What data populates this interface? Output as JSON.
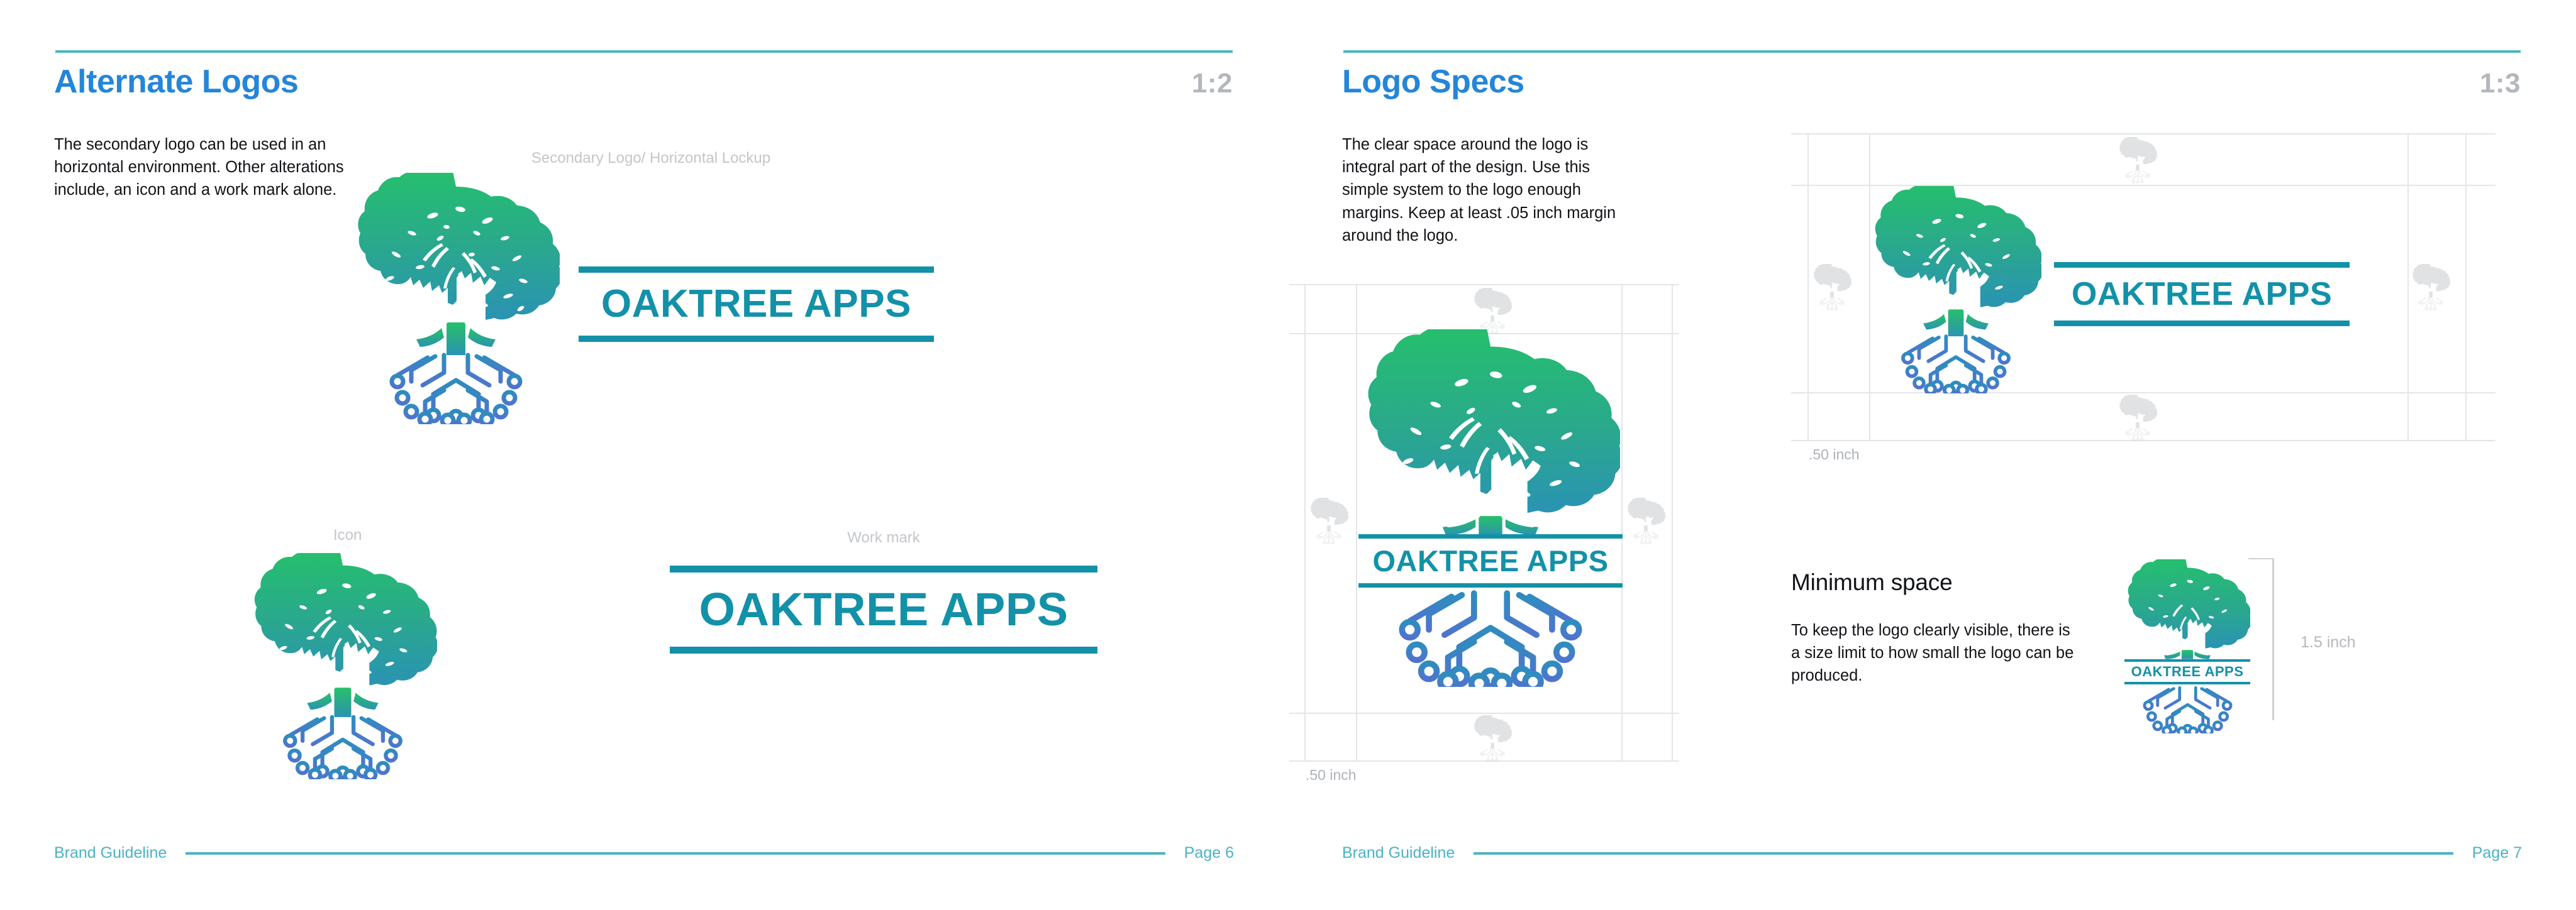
{
  "brand": {
    "wordmark": "OAKTREE APPS",
    "colors": {
      "heading_blue": "#2486d8",
      "rule_teal": "#4bb3c4",
      "wordmark_teal": "#1391a8",
      "canopy_green": "#25c16a",
      "canopy_teal": "#2a9fb0",
      "root_blue": "#4a7fd0",
      "caption_gray": "#c3c6cb",
      "body_black": "#111317",
      "guide_gray": "#e3e5e8"
    }
  },
  "pages": [
    {
      "title": "Alternate Logos",
      "ratio": "1:2",
      "body": "The secondary logo can be used in an horizontal environment. Other alterations include, an icon and a work mark alone.",
      "captions": {
        "secondary": "Secondary Logo/ Horizontal Lockup",
        "icon": "Icon",
        "workmark": "Work mark"
      },
      "footer": {
        "label": "Brand Guideline",
        "page": "Page 6"
      }
    },
    {
      "title": "Logo Specs",
      "ratio": "1:3",
      "body": "The clear space around the logo is integral part of the design. Use this simple system to the logo enough margins. Keep at least .05 inch margin around the logo.",
      "clearspace": {
        "horizontal_label": ".50 inch",
        "vertical_label": ".50 inch"
      },
      "minimum": {
        "heading": "Minimum space",
        "body": "To keep the logo clearly visible, there is a size limit to how small the logo can be produced.",
        "dimension": "1.5 inch"
      },
      "footer": {
        "label": "Brand Guideline",
        "page": "Page 7"
      }
    }
  ]
}
